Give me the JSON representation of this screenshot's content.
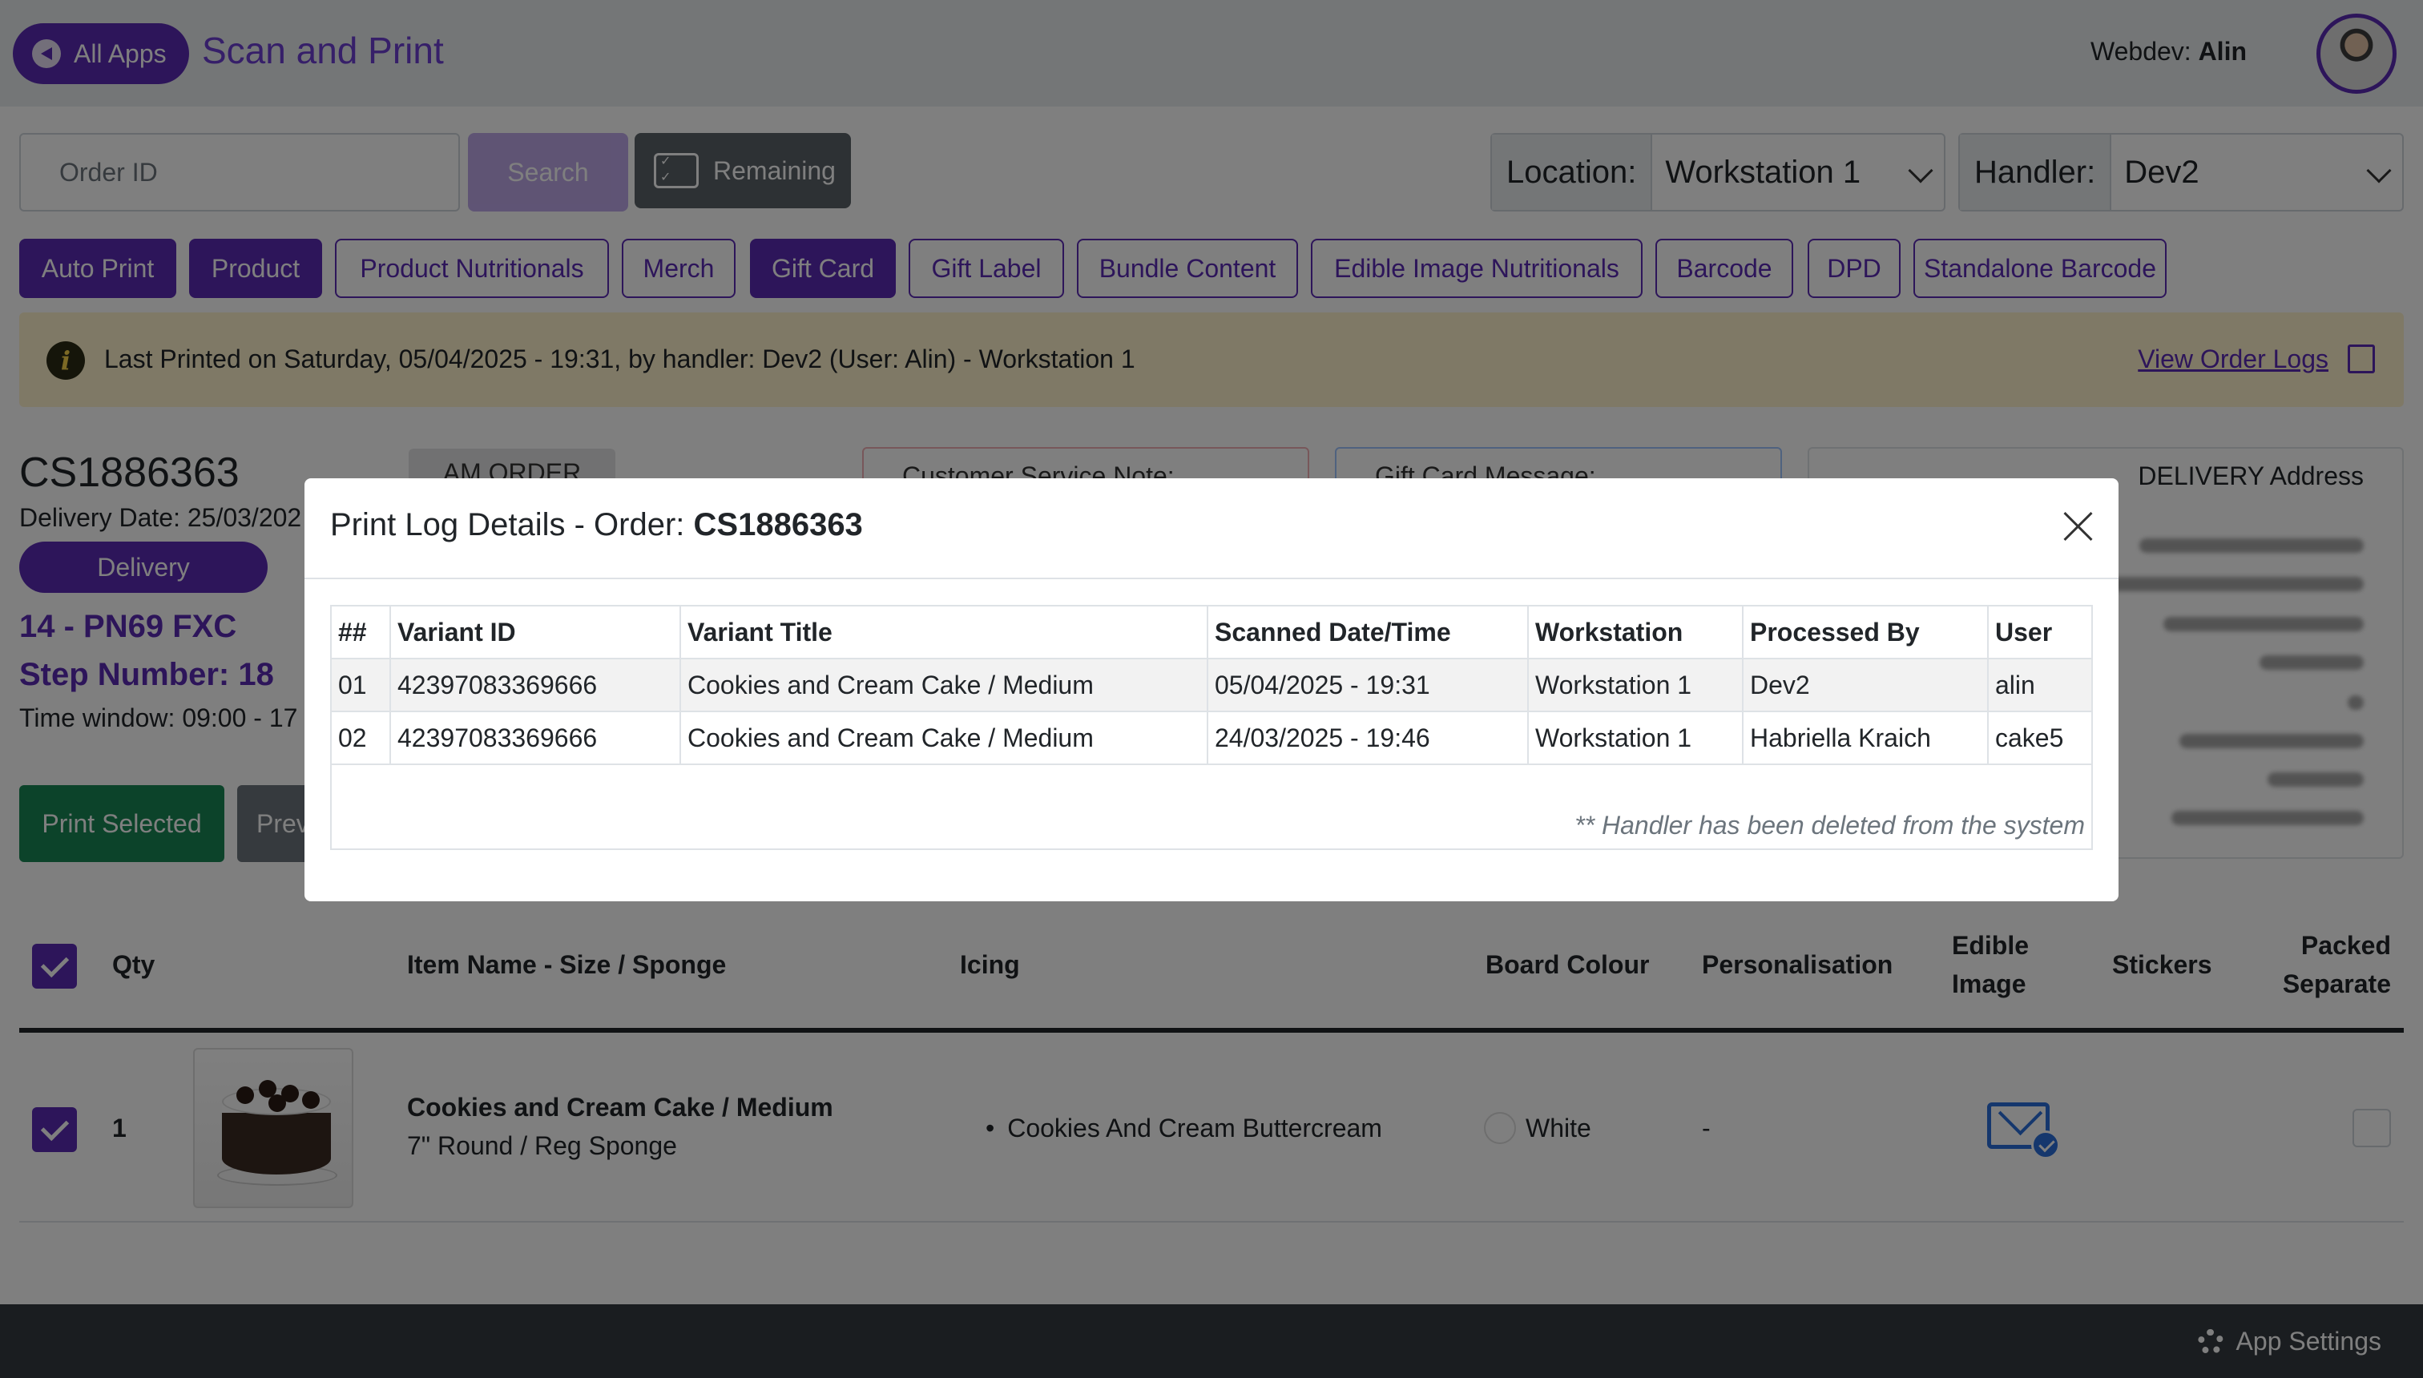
{
  "header": {
    "all_apps_label": "All Apps",
    "app_title": "Scan and Print",
    "user_prefix": "Webdev:",
    "user_name": "Alin"
  },
  "search": {
    "placeholder": "Order ID",
    "search_label": "Search",
    "remaining_label": "Remaining"
  },
  "location": {
    "label": "Location:",
    "value": "Workstation 1"
  },
  "handler": {
    "label": "Handler:",
    "value": "Dev2"
  },
  "tabs": [
    {
      "label": "Auto Print",
      "active": true
    },
    {
      "label": "Product",
      "active": true
    },
    {
      "label": "Product Nutritionals",
      "active": false
    },
    {
      "label": "Merch",
      "active": false
    },
    {
      "label": "Gift Card",
      "active": true
    },
    {
      "label": "Gift Label",
      "active": false
    },
    {
      "label": "Bundle Content",
      "active": false
    },
    {
      "label": "Edible Image Nutritionals",
      "active": false
    },
    {
      "label": "Barcode",
      "active": false
    },
    {
      "label": "DPD",
      "active": false
    },
    {
      "label": "Standalone Barcode",
      "active": false
    }
  ],
  "alert": {
    "text": "Last Printed on Saturday, 05/04/2025 - 19:31, by handler: Dev2 (User: Alin) - Workstation 1",
    "link": "View Order Logs"
  },
  "order": {
    "number": "CS1886363",
    "delivery_date": "Delivery Date: 25/03/202",
    "delivery_type": "Delivery",
    "route": "14 - PN69 FXC",
    "step": "Step Number: 18",
    "time_window": "Time window: 09:00 - 17",
    "am_badge": "AM ORDER",
    "cs_note": "Customer Service Note:",
    "gift_message": "Gift Card Message:",
    "address_heading": "DELIVERY Address"
  },
  "actions": {
    "print_selected": "Print Selected",
    "preview": "Prev"
  },
  "items_table": {
    "headers": {
      "qty": "Qty",
      "item": "Item Name - Size / Sponge",
      "icing": "Icing",
      "board": "Board Colour",
      "personalisation": "Personalisation",
      "edible1": "Edible",
      "edible2": "Image",
      "stickers": "Stickers",
      "packed1": "Packed",
      "packed2": "Separate"
    },
    "rows": [
      {
        "qty": "1",
        "name": "Cookies and Cream Cake / Medium",
        "sub": "7\" Round / Reg Sponge",
        "icing": "Cookies And Cream Buttercream",
        "board": "White",
        "personalisation": "-"
      }
    ]
  },
  "footer": {
    "settings_label": "App Settings"
  },
  "modal": {
    "title_prefix": "Print Log Details - Order:",
    "title_order": "CS1886363",
    "columns": [
      "##",
      "Variant ID",
      "Variant Title",
      "Scanned Date/Time",
      "Workstation",
      "Processed By",
      "User"
    ],
    "rows": [
      [
        "01",
        "42397083369666",
        "Cookies and Cream Cake / Medium",
        "05/04/2025 - 19:31",
        "Workstation 1",
        "Dev2",
        "alin"
      ],
      [
        "02",
        "42397083369666",
        "Cookies and Cream Cake / Medium",
        "24/03/2025 - 19:46",
        "Workstation 1",
        "Habriella Kraich",
        "cake5"
      ]
    ],
    "footnote": "** Handler has been deleted from the system"
  },
  "colors": {
    "brand": "#5b2bb5",
    "success": "#198754",
    "alert_bg": "#fff3cd",
    "footer_bg": "#343a40"
  }
}
